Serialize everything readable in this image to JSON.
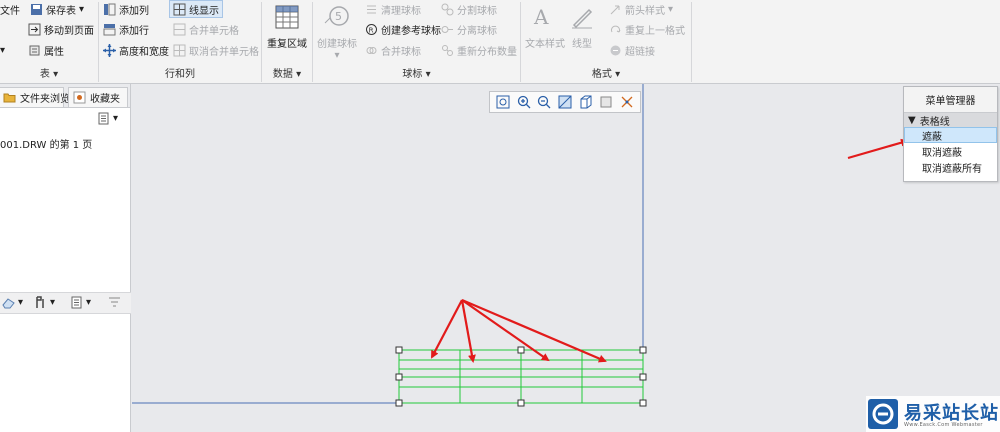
{
  "ribbon": {
    "g1": {
      "items": [
        "文件",
        "保存表",
        "移动到页面",
        "属性"
      ],
      "label": "表"
    },
    "g2": {
      "items": [
        "添加列",
        "线显示",
        "添加行",
        "合并单元格",
        "高度和宽度",
        "取消合并单元格"
      ],
      "label": "行和列"
    },
    "g3": {
      "big": "重复区域",
      "label": "数据"
    },
    "g4": {
      "big": "创建球标",
      "items": [
        "清理球标",
        "分割球标",
        "创建参考球标",
        "分离球标",
        "合并球标",
        "重新分布数量"
      ],
      "label": "球标"
    },
    "g5": {
      "big1": "文本样式",
      "big2": "线型",
      "items": [
        "箭头样式",
        "重复上一格式",
        "超链接"
      ],
      "label": "格式"
    }
  },
  "left_panel": {
    "tabs": [
      "文件夹浏览...",
      "收藏夹"
    ],
    "tree_line": "001.DRW 的第 1 页"
  },
  "menu_manager": {
    "title": "菜单管理器",
    "section": "表格线",
    "items": [
      "遮蔽",
      "取消遮蔽",
      "取消遮蔽所有"
    ]
  },
  "watermark": {
    "text": "易采站长站",
    "sub": "Www.Easck.Com Webmaster"
  },
  "colors": {
    "table_line": "#22c93a",
    "arrow": "#e21b1b",
    "border_blue": "#4a6fb5",
    "selected": "#cfe7fb"
  }
}
